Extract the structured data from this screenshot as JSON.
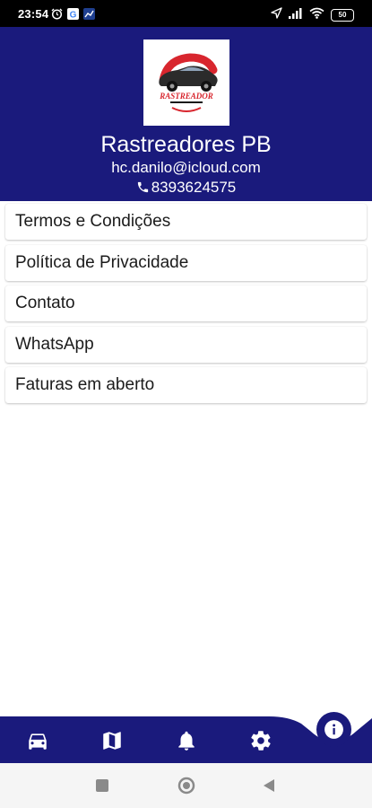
{
  "status_bar": {
    "time": "23:54",
    "battery": "50"
  },
  "header": {
    "logo_text": "RASTREADOR",
    "company_name": "Rastreadores PB",
    "email": "hc.danilo@icloud.com",
    "phone": "8393624575"
  },
  "menu": {
    "items": [
      {
        "label": "Termos e Condições"
      },
      {
        "label": "Política de Privacidade"
      },
      {
        "label": "Contato"
      },
      {
        "label": "WhatsApp"
      },
      {
        "label": "Faturas em aberto"
      }
    ]
  },
  "bottom_nav": {
    "icons": [
      "car-icon",
      "map-icon",
      "bell-icon",
      "gear-icon",
      "info-icon"
    ]
  },
  "colors": {
    "primary": "#1a1a7c",
    "logo_red": "#d8262e"
  }
}
